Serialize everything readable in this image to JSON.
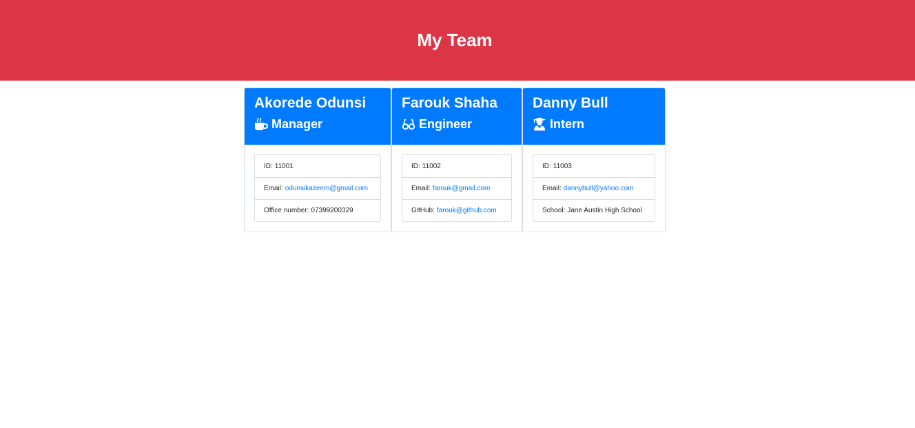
{
  "header": {
    "title": "My Team"
  },
  "theme": {
    "banner_color": "#dc3545",
    "card_header_color": "#007bff",
    "link_color": "#007bff"
  },
  "team": [
    {
      "name": "Akorede Odunsi",
      "role": "Manager",
      "role_icon": "mug-icon",
      "id_label": "ID:",
      "id": "11001",
      "email_label": "Email:",
      "email": "odunsikazeem@gmail.com",
      "extra_label": "Office number:",
      "extra_value": "07399200329"
    },
    {
      "name": "Farouk Shaha",
      "role": "Engineer",
      "role_icon": "glasses-icon",
      "id_label": "ID:",
      "id": "11002",
      "email_label": "Email:",
      "email": "farouk@gmail.com",
      "extra_label": "GitHub:",
      "extra_value": "farouk@github.com"
    },
    {
      "name": "Danny Bull",
      "role": "Intern",
      "role_icon": "graduate-icon",
      "id_label": "ID:",
      "id": "11003",
      "email_label": "Email:",
      "email": "dannybull@yahoo.com",
      "extra_label": "School:",
      "extra_value": "Jane Austin High School"
    }
  ]
}
